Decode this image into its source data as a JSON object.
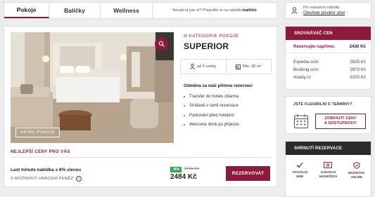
{
  "tabs": [
    {
      "label": "Pokoje",
      "active": true
    },
    {
      "label": "Balíčky",
      "active": false
    },
    {
      "label": "Wellness",
      "active": false
    }
  ],
  "signup_note": {
    "text": "Nevybral jste si? Přepněte si na nabídku ",
    "link": "balíčků"
  },
  "private_offers": {
    "line1": "Pro exkluzivní nabídky",
    "line2": "Otevřete privátní účet",
    "icon": "user-icon"
  },
  "room": {
    "category": "KATEGORIE POKOJE",
    "title": "SUPERIOR",
    "detail_button": "DETAIL POKOJE",
    "occupancy": "až 3 osoby",
    "size": "Min. 30 m²",
    "benefits_heading": "Odměna za vaši přímou rezervaci",
    "benefits": [
      "Transfer do hotelu zdarma",
      "Snídaně v ceně rezervace",
      "Parkování před hotelem",
      "Welcome drink po příjezdu"
    ],
    "best_price_label": "NEJLEPŠÍ CENY PRO VÁS",
    "offer": "Last minute nabídka s 8% slevou",
    "refund": "S MOŽNOSTÍ VRÁCENÍ PENĚZ",
    "discount": "-8%",
    "old_price": "2700 Kč",
    "price": "2484 Kč",
    "book_button": "REZERVOVAT"
  },
  "comparison": {
    "title": "SROVNÁVAČ CEN",
    "direct": {
      "label": "Rezervujte napřímo:",
      "value": "2430 Kč"
    },
    "others": [
      {
        "label": "Expedia.com",
        "value": "2835 Kč"
      },
      {
        "label": "Booking.com",
        "value": "2970 Kč"
      },
      {
        "label": "Hotely.cz",
        "value": "5200 Kč"
      }
    ]
  },
  "flexible": {
    "question": "JSTE FLEXIBILNÍ S TERMÍNY?",
    "button_line1": "ZOBRAZIT CENY",
    "button_line2": "A DOSTUPNOSTI"
  },
  "summary": {
    "title": "SHRNUTÍ REZERVACE",
    "items": [
      {
        "line1": "OFICIÁLNÍ",
        "line2": "WEB",
        "icon": "checkmark-icon"
      },
      {
        "line1": "GARANCE",
        "line2": "NEJNIŽŠÍCH",
        "icon": "money-icon"
      },
      {
        "line1": "BEZPEČNÁ",
        "line2": "ONLINE",
        "icon": "shield-icon"
      }
    ]
  },
  "colors": {
    "brand": "#8e1a3b",
    "discount": "#2ea84a"
  }
}
